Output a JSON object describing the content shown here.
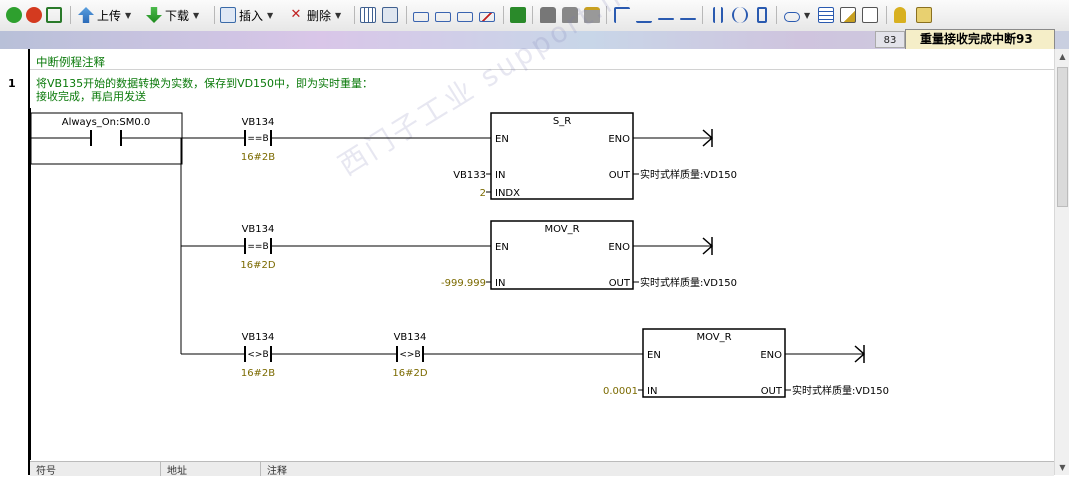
{
  "toolbar": {
    "upload": "上传",
    "download": "下载",
    "insert": "插入",
    "delete": "删除"
  },
  "tabs": {
    "num": "83",
    "active": "重量接收完成中断93"
  },
  "editor": {
    "title_comment": "中断例程注释",
    "network_number": "1",
    "network_comment_line1": "将VB135开始的数据转换为实数，保存到VD150中，即为实时重量：",
    "network_comment_line2": "接收完成，再启用发送"
  },
  "ladder": {
    "contact_always": "Always_On:SM0.0",
    "rung1": {
      "cmp_addr": "VB134",
      "cmp_op": "==B",
      "cmp_value": "16#2B",
      "box_title": "S_R",
      "en": "EN",
      "eno": "ENO",
      "in_label": "IN",
      "in_value": "VB133",
      "indx_label": "INDX",
      "indx_value": "2",
      "out_label": "OUT",
      "out_value": "实时式样质量:VD150"
    },
    "rung2": {
      "cmp_addr": "VB134",
      "cmp_op": "==B",
      "cmp_value": "16#2D",
      "box_title": "MOV_R",
      "en": "EN",
      "eno": "ENO",
      "in_label": "IN",
      "in_value": "-999.999",
      "out_label": "OUT",
      "out_value": "实时式样质量:VD150"
    },
    "rung3": {
      "cmp1_addr": "VB134",
      "cmp1_op": "<>B",
      "cmp1_value": "16#2B",
      "cmp2_addr": "VB134",
      "cmp2_op": "<>B",
      "cmp2_value": "16#2D",
      "box_title": "MOV_R",
      "en": "EN",
      "eno": "ENO",
      "in_label": "IN",
      "in_value": "0.0001",
      "out_label": "OUT",
      "out_value": "实时式样质量:VD150"
    }
  },
  "bottom": {
    "col1": "符号",
    "col2": "地址",
    "col3": "注释"
  },
  "watermark": "西门子工业 support.industry.siemens 技术论坛",
  "colors": {
    "comment": "#0a7a0a",
    "literal": "#7b6a00",
    "active_tab": "#f5eec8"
  }
}
